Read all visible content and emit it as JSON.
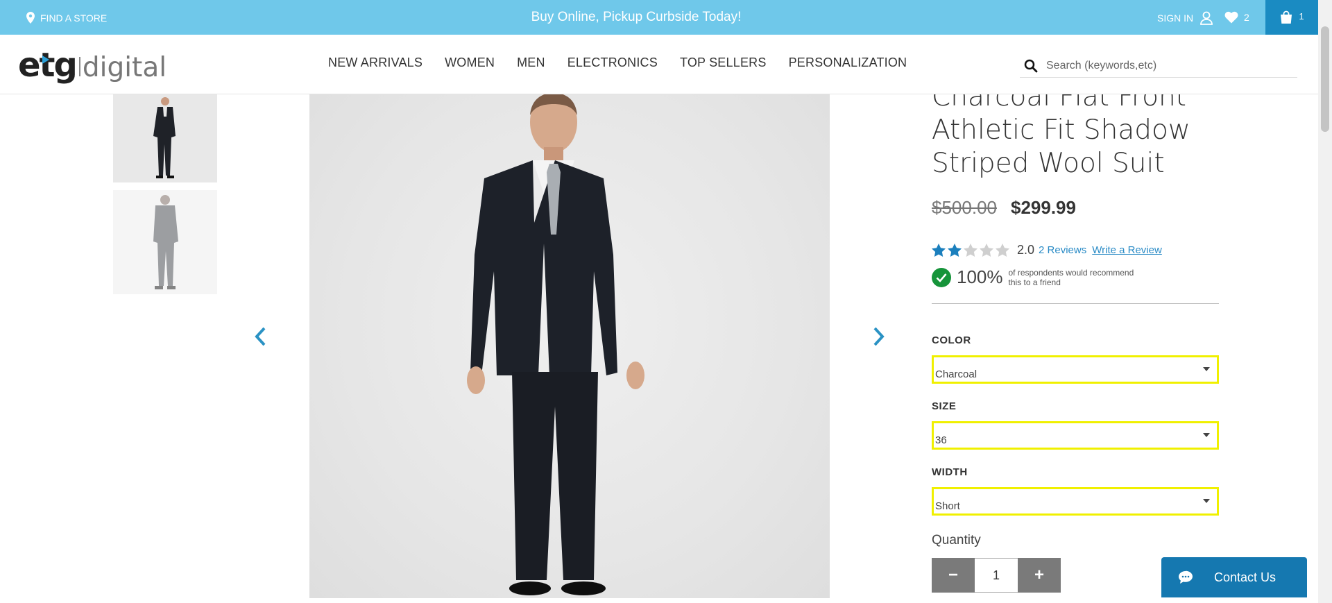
{
  "topbar": {
    "find_store": "FIND A STORE",
    "promo": "Buy Online, Pickup Curbside Today!",
    "sign_in": "SIGN IN",
    "wishlist_count": "2",
    "cart_count": "1"
  },
  "header": {
    "logo_etg": "etg",
    "logo_digital": "digital",
    "nav": [
      "NEW ARRIVALS",
      "WOMEN",
      "MEN",
      "ELECTRONICS",
      "TOP SELLERS",
      "PERSONALIZATION"
    ],
    "search_placeholder": "Search (keywords,etc)"
  },
  "product": {
    "title": "Charcoal Flat Front Athletic Fit Shadow Striped Wool Suit",
    "old_price": "$500.00",
    "price": "$299.99",
    "rating_value": "2.0",
    "rating_stars": 2,
    "reviews_link": "2 Reviews",
    "write_review": "Write a Review",
    "recommend_pct": "100%",
    "recommend_text": "of respondents would recommend this to a friend"
  },
  "options": {
    "color_label": "COLOR",
    "color_value": "Charcoal",
    "size_label": "SIZE",
    "size_value": "36",
    "width_label": "WIDTH",
    "width_value": "Short"
  },
  "quantity": {
    "label": "Quantity",
    "minus": "−",
    "value": "1",
    "plus": "+"
  },
  "contact": {
    "label": "Contact Us"
  },
  "colors": {
    "topbar": "#6fc8ea",
    "cart": "#1a8bc2",
    "link": "#2a8bc6",
    "star": "#1b7fbd",
    "highlight": "#f0f000",
    "contact": "#1578b0"
  }
}
